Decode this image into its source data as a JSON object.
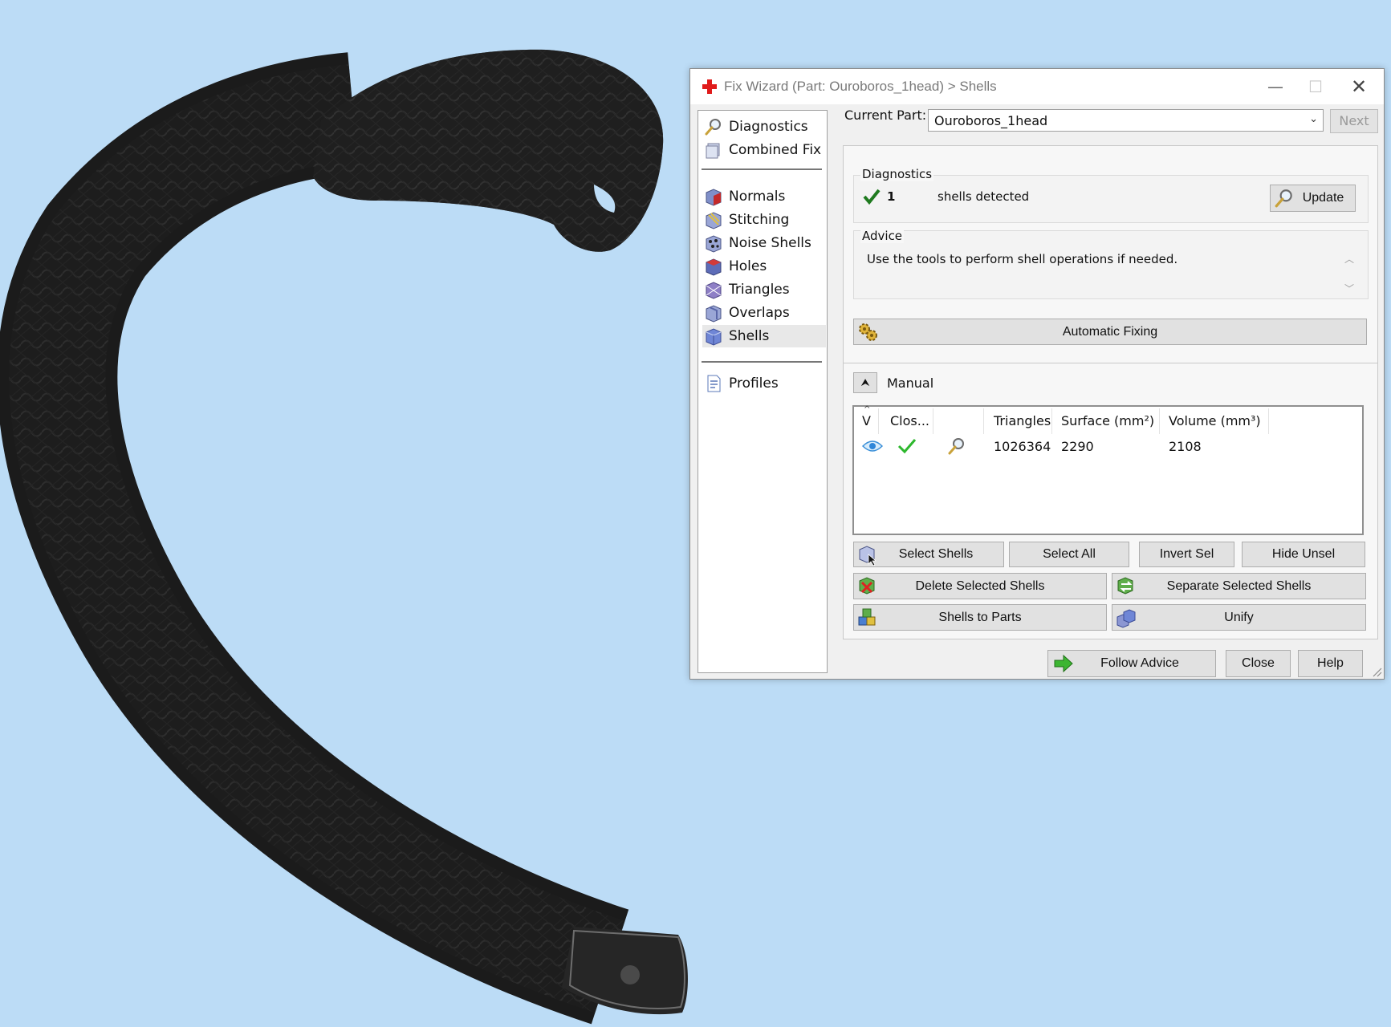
{
  "dialog": {
    "title": "Fix Wizard (Part: Ouroboros_1head) > Shells",
    "min_symbol": "—",
    "max_symbol": "☐",
    "close_symbol": "✕"
  },
  "nav": {
    "items": [
      {
        "label": "Diagnostics",
        "icon": "magnifier-icon"
      },
      {
        "label": "Combined Fix",
        "icon": "combined-fix-icon"
      },
      {
        "label": "Normals",
        "icon": "normals-cube-icon"
      },
      {
        "label": "Stitching",
        "icon": "stitching-cube-icon"
      },
      {
        "label": "Noise Shells",
        "icon": "noise-shells-cube-icon"
      },
      {
        "label": "Holes",
        "icon": "holes-cube-icon"
      },
      {
        "label": "Triangles",
        "icon": "triangles-cube-icon"
      },
      {
        "label": "Overlaps",
        "icon": "overlaps-cube-icon"
      },
      {
        "label": "Shells",
        "icon": "shells-cube-icon"
      },
      {
        "label": "Profiles",
        "icon": "profiles-document-icon"
      }
    ],
    "active": "Shells"
  },
  "current_part": {
    "label": "Current Part:",
    "value": "Ouroboros_1head",
    "next_label": "Next"
  },
  "diagnostics": {
    "group_label": "Diagnostics",
    "count": "1",
    "text": "shells detected",
    "update_label": "Update"
  },
  "advice": {
    "group_label": "Advice",
    "text": "Use the tools to perform shell operations if needed.",
    "scroll_up": "︿",
    "scroll_down": "﹀"
  },
  "automatic_fixing_label": "Automatic Fixing",
  "manual": {
    "label": "Manual",
    "collapse_symbol": "⮝",
    "table": {
      "headers": [
        "V",
        "Clos...",
        "",
        "Triangles",
        "Surface (mm²)",
        "Volume (mm³)"
      ],
      "rows": [
        {
          "visible_icon": "eye-icon",
          "closed_icon": "check-icon",
          "inspect_icon": "magnifier-icon",
          "triangles": "1026364",
          "surface": "2290",
          "volume": "2108"
        }
      ]
    },
    "buttons": {
      "select_shells": "Select Shells",
      "select_all": "Select All",
      "invert_sel": "Invert Sel",
      "hide_unsel": "Hide Unsel",
      "delete_selected": "Delete Selected Shells",
      "separate_selected": "Separate Selected Shells",
      "shells_to_parts": "Shells to Parts",
      "unify": "Unify"
    }
  },
  "footer": {
    "follow_advice": "Follow Advice",
    "close": "Close",
    "help": "Help"
  },
  "colors": {
    "viewport_bg": "#bcdcf6",
    "model": "#1e1e1e",
    "check_green": "#2db82d",
    "arrow_green": "#3cb531",
    "title_cross": "#e01b1b"
  }
}
